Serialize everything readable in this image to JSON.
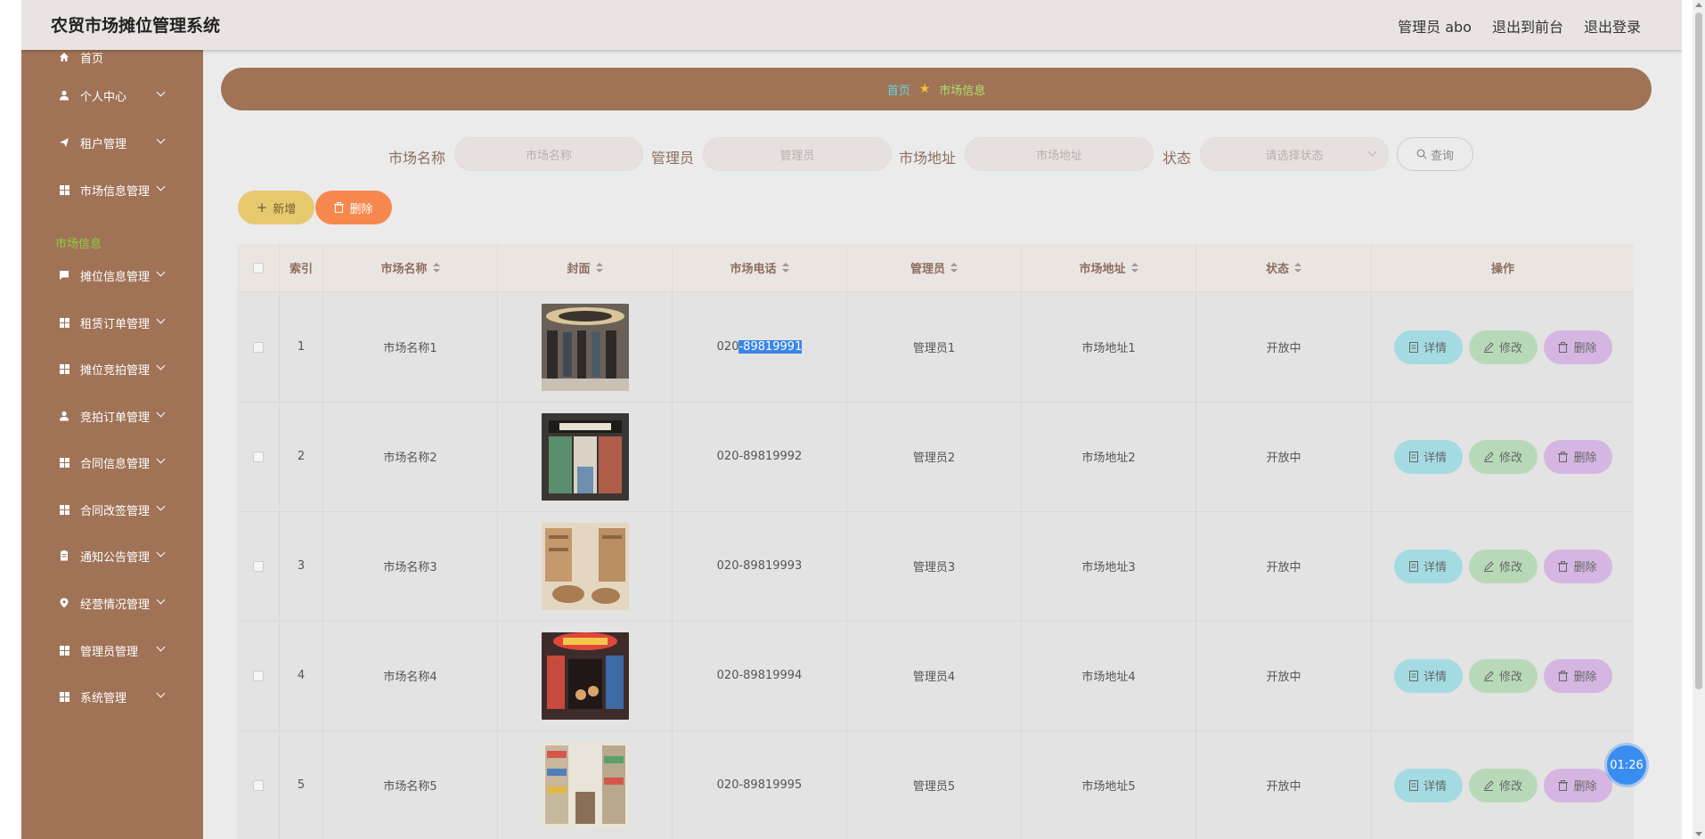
{
  "header": {
    "title": "农贸市场摊位管理系统",
    "user": "管理员 abo",
    "to_front": "退出到前台",
    "logout": "退出登录"
  },
  "sidebar": {
    "items": [
      {
        "label": "首页",
        "icon": "home-icon",
        "expandable": false
      },
      {
        "label": "个人中心",
        "icon": "user-icon",
        "expandable": true
      },
      {
        "label": "租户管理",
        "icon": "send-icon",
        "expandable": true
      },
      {
        "label": "市场信息管理",
        "icon": "grid-icon",
        "expandable": true
      },
      {
        "label": "摊位信息管理",
        "icon": "message-icon",
        "expandable": true
      },
      {
        "label": "租赁订单管理",
        "icon": "grid-icon",
        "expandable": true
      },
      {
        "label": "摊位竞拍管理",
        "icon": "grid-icon",
        "expandable": true
      },
      {
        "label": "竞拍订单管理",
        "icon": "user-icon",
        "expandable": true
      },
      {
        "label": "合同信息管理",
        "icon": "grid-icon",
        "expandable": true
      },
      {
        "label": "合同改签管理",
        "icon": "grid-icon",
        "expandable": true
      },
      {
        "label": "通知公告管理",
        "icon": "notice-icon",
        "expandable": true
      },
      {
        "label": "经营情况管理",
        "icon": "location-icon",
        "expandable": true
      },
      {
        "label": "管理员管理",
        "icon": "grid-icon",
        "expandable": true
      },
      {
        "label": "系统管理",
        "icon": "grid-icon",
        "expandable": true
      }
    ],
    "active_sub": "市场信息"
  },
  "breadcrumb": {
    "home": "首页",
    "current": "市场信息"
  },
  "search": {
    "market_name_label": "市场名称",
    "market_name_placeholder": "市场名称",
    "manager_label": "管理员",
    "manager_placeholder": "管理员",
    "address_label": "市场地址",
    "address_placeholder": "市场地址",
    "status_label": "状态",
    "status_placeholder": "请选择状态",
    "query_label": "查询"
  },
  "actions": {
    "add": "新增",
    "delete": "删除"
  },
  "table": {
    "headers": [
      "索引",
      "市场名称",
      "封面",
      "市场电话",
      "管理员",
      "市场地址",
      "状态",
      "操作"
    ],
    "rows": [
      {
        "index": "1",
        "name": "市场名称1",
        "phone_a": "020",
        "phone_b": "-89819991",
        "manager": "管理员1",
        "address": "市场地址1",
        "status": "开放中"
      },
      {
        "index": "2",
        "name": "市场名称2",
        "phone_a": "020-89819992",
        "phone_b": "",
        "manager": "管理员2",
        "address": "市场地址2",
        "status": "开放中"
      },
      {
        "index": "3",
        "name": "市场名称3",
        "phone_a": "020-89819993",
        "phone_b": "",
        "manager": "管理员3",
        "address": "市场地址3",
        "status": "开放中"
      },
      {
        "index": "4",
        "name": "市场名称4",
        "phone_a": "020-89819994",
        "phone_b": "",
        "manager": "管理员4",
        "address": "市场地址4",
        "status": "开放中"
      },
      {
        "index": "5",
        "name": "市场名称5",
        "phone_a": "020-89819995",
        "phone_b": "",
        "manager": "管理员5",
        "address": "市场地址5",
        "status": "开放中"
      }
    ],
    "op_detail": "详情",
    "op_edit": "修改",
    "op_delete": "删除"
  },
  "timer": "01:26",
  "colors": {
    "sidebar": "#a07357",
    "accent_green": "#8ccf3f",
    "add_btn": "#e6c96f",
    "del_btn": "#f6884e"
  }
}
